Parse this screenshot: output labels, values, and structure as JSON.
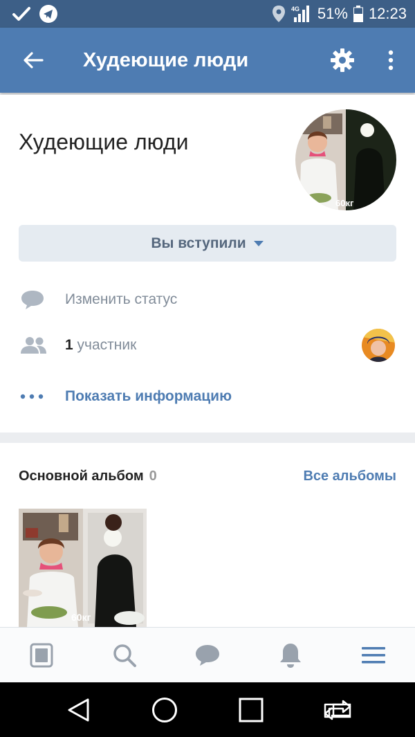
{
  "status_bar": {
    "network": "4G",
    "battery": "51%",
    "time": "12:23",
    "icons": [
      "check-icon",
      "telegram-icon",
      "location-icon",
      "signal-icon",
      "battery-icon"
    ]
  },
  "app_bar": {
    "title": "Худеющие люди",
    "back_icon": "arrow-left-icon",
    "settings_icon": "gear-icon",
    "more_icon": "more-vertical-icon"
  },
  "group": {
    "name": "Худеющие люди",
    "avatar_caption": "60кг",
    "joined_label": "Вы вступили",
    "change_status_label": "Изменить статус",
    "members_count": "1",
    "members_label": "участник",
    "show_info_label": "Показать информацию"
  },
  "album": {
    "title": "Основной альбом",
    "count": "0",
    "all_albums_label": "Все альбомы",
    "thumb_caption": "60кг"
  },
  "bottom_nav": {
    "items": [
      "news-icon",
      "search-icon",
      "messages-icon",
      "notifications-icon",
      "menu-icon"
    ],
    "active": "menu-icon"
  },
  "system_nav": [
    "back-triangle-icon",
    "home-circle-icon",
    "recents-square-icon",
    "switch-app-icon"
  ],
  "colors": {
    "status_bar": "#3d5f87",
    "app_bar": "#4e7cb2",
    "accent": "#4e7cb2",
    "icon_gray": "#99a2ad"
  }
}
